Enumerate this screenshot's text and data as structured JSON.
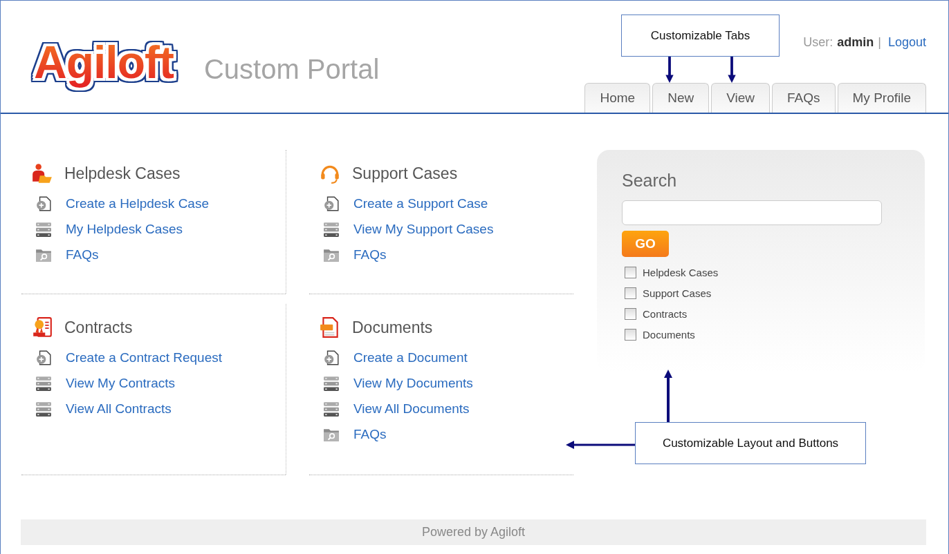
{
  "header": {
    "logo": "Agiloft",
    "portal_title": "Custom Portal",
    "user_label": "User:",
    "user_name": "admin",
    "separator": "|",
    "logout": "Logout"
  },
  "tabs": [
    {
      "label": "Home"
    },
    {
      "label": "New"
    },
    {
      "label": "View"
    },
    {
      "label": "FAQs"
    },
    {
      "label": "My Profile"
    }
  ],
  "sections": [
    {
      "kind": "helpdesk",
      "title": "Helpdesk Cases",
      "links": [
        {
          "kind": "create",
          "label": "Create a Helpdesk Case"
        },
        {
          "kind": "list",
          "label": "My Helpdesk Cases"
        },
        {
          "kind": "faq",
          "label": "FAQs"
        }
      ]
    },
    {
      "kind": "support",
      "title": "Support Cases",
      "links": [
        {
          "kind": "create",
          "label": "Create a Support Case"
        },
        {
          "kind": "list",
          "label": "View My Support Cases"
        },
        {
          "kind": "faq",
          "label": "FAQs"
        }
      ]
    },
    {
      "kind": "contracts",
      "title": "Contracts",
      "links": [
        {
          "kind": "create",
          "label": "Create a Contract Request"
        },
        {
          "kind": "list",
          "label": "View My Contracts"
        },
        {
          "kind": "list",
          "label": "View All Contracts"
        }
      ]
    },
    {
      "kind": "documents",
      "title": "Documents",
      "links": [
        {
          "kind": "create",
          "label": "Create a Document"
        },
        {
          "kind": "list",
          "label": "View My Documents"
        },
        {
          "kind": "list",
          "label": "View All Documents"
        },
        {
          "kind": "faq",
          "label": "FAQs"
        }
      ]
    }
  ],
  "search": {
    "title": "Search",
    "button": "GO",
    "options": [
      {
        "label": "Helpdesk Cases",
        "checked": false
      },
      {
        "label": "Support Cases",
        "checked": false
      },
      {
        "label": "Contracts",
        "checked": false
      },
      {
        "label": "Documents",
        "checked": false
      }
    ]
  },
  "annotations": [
    {
      "kind": "tabs",
      "text": "Customizable Tabs"
    },
    {
      "kind": "layout",
      "text": "Customizable Layout and Buttons"
    }
  ],
  "footer": "Powered by Agiloft"
}
